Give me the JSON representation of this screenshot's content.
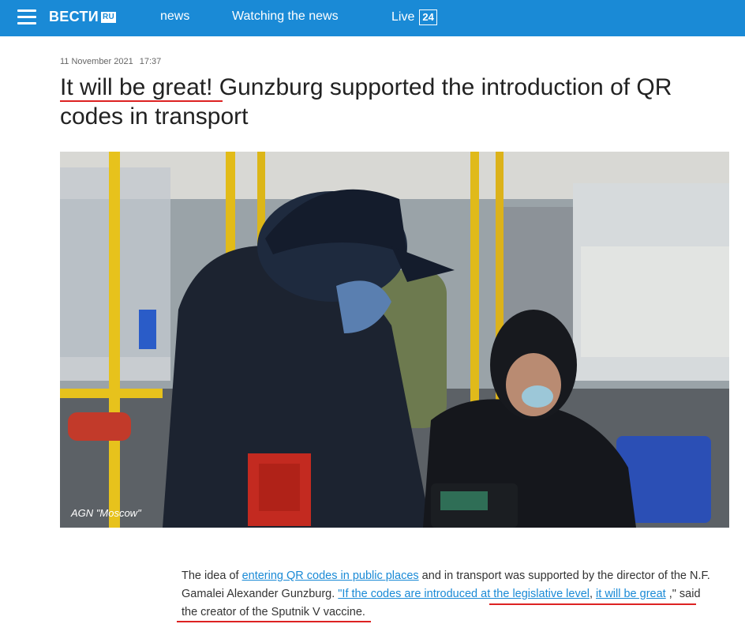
{
  "header": {
    "logo": "ВЕСТИ",
    "logo_ru": "RU",
    "nav": [
      {
        "label": "news"
      },
      {
        "label": "Watching the news"
      },
      {
        "label": "Live",
        "badge": "24"
      }
    ]
  },
  "article": {
    "date": "11 November 2021",
    "time": "17:37",
    "headline": "It will be great! Gunzburg supported the introduction of QR codes in transport",
    "photo_credit": "AGN \"Moscow\"",
    "lead": {
      "p1": "The idea of ",
      "link1": "entering QR codes in public places",
      "p2": " and in transport was supported by the director of the N.F. Gamalei Alexander Gunzburg. ",
      "quote_link1": "\"If the codes are introduced at the legislative level",
      "quote_sep": ", ",
      "quote_link2": "it will be great",
      "p3": " ,\" said the creator of the Sputnik V vaccine."
    }
  },
  "colors": {
    "brand": "#1a8ad6",
    "annotation": "#dd2222"
  }
}
